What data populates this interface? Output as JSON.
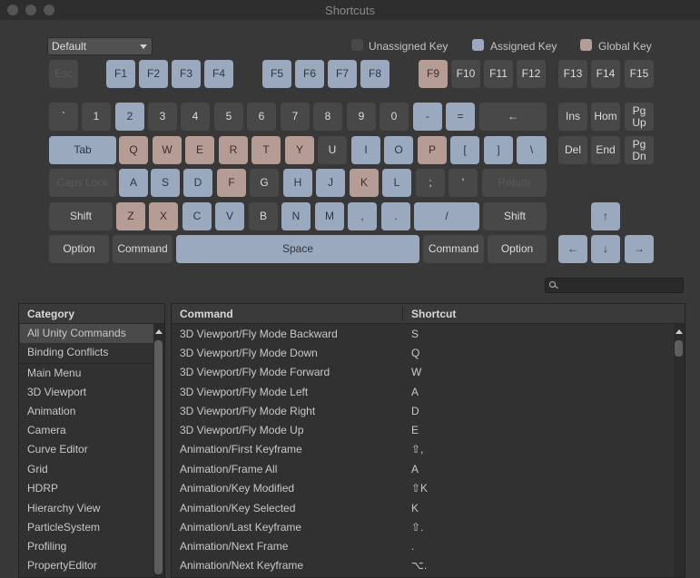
{
  "window": {
    "title": "Shortcuts"
  },
  "profile_dropdown": {
    "value": "Default"
  },
  "legend": {
    "unassigned": "Unassigned Key",
    "assigned": "Assigned Key",
    "global": "Global Key",
    "colors": {
      "unassigned": "#484848",
      "assigned": "#9aa9bd",
      "global": "#b59d95"
    }
  },
  "keys": {
    "esc": "Esc",
    "f1": "F1",
    "f2": "F2",
    "f3": "F3",
    "f4": "F4",
    "f5": "F5",
    "f6": "F6",
    "f7": "F7",
    "f8": "F8",
    "f9": "F9",
    "f10": "F10",
    "f11": "F11",
    "f12": "F12",
    "f13": "F13",
    "f14": "F14",
    "f15": "F15",
    "backtick": "`",
    "n1": "1",
    "n2": "2",
    "n3": "3",
    "n4": "4",
    "n5": "5",
    "n6": "6",
    "n7": "7",
    "n8": "8",
    "n9": "9",
    "n0": "0",
    "minus": "-",
    "equals": "=",
    "backspace": "←",
    "ins": "Ins",
    "home": "Hom",
    "pgup1": "Pg",
    "pgup2": "Up",
    "tab": "Tab",
    "q": "Q",
    "w": "W",
    "e": "E",
    "r": "R",
    "t": "T",
    "y": "Y",
    "u": "U",
    "i": "I",
    "o": "O",
    "p": "P",
    "lbracket": "[",
    "rbracket": "]",
    "backslash": "\\",
    "del": "Del",
    "end": "End",
    "pgdn1": "Pg",
    "pgdn2": "Dn",
    "capslock": "Caps Lock",
    "a": "A",
    "s": "S",
    "d": "D",
    "f": "F",
    "g": "G",
    "h": "H",
    "j": "J",
    "k": "K",
    "l": "L",
    "semicolon": ";",
    "quote": "'",
    "return": "Return",
    "shift_l": "Shift",
    "z": "Z",
    "x": "X",
    "c": "C",
    "v": "V",
    "b": "B",
    "n": "N",
    "m": "M",
    "comma": ",",
    "period": ".",
    "slash": "/",
    "shift_r": "Shift",
    "option_l": "Option",
    "command_l": "Command",
    "space": "Space",
    "command_r": "Command",
    "option_r": "Option",
    "arrow_up": "↑",
    "arrow_left": "←",
    "arrow_down": "↓",
    "arrow_right": "→"
  },
  "category_panel": {
    "header": "Category",
    "items": [
      "All Unity Commands",
      "Binding Conflicts",
      "Main Menu",
      "3D Viewport",
      "Animation",
      "Camera",
      "Curve Editor",
      "Grid",
      "HDRP",
      "Hierarchy View",
      "ParticleSystem",
      "Profiling",
      "PropertyEditor"
    ],
    "selected": "All Unity Commands"
  },
  "command_table": {
    "headers": {
      "command": "Command",
      "shortcut": "Shortcut"
    },
    "rows": [
      {
        "command": "3D Viewport/Fly Mode Backward",
        "shortcut": "S"
      },
      {
        "command": "3D Viewport/Fly Mode Down",
        "shortcut": "Q"
      },
      {
        "command": "3D Viewport/Fly Mode Forward",
        "shortcut": "W"
      },
      {
        "command": "3D Viewport/Fly Mode Left",
        "shortcut": "A"
      },
      {
        "command": "3D Viewport/Fly Mode Right",
        "shortcut": "D"
      },
      {
        "command": "3D Viewport/Fly Mode Up",
        "shortcut": "E"
      },
      {
        "command": "Animation/First Keyframe",
        "shortcut": "⇧,"
      },
      {
        "command": "Animation/Frame All",
        "shortcut": "A"
      },
      {
        "command": "Animation/Key Modified",
        "shortcut": "⇧K"
      },
      {
        "command": "Animation/Key Selected",
        "shortcut": "K"
      },
      {
        "command": "Animation/Last Keyframe",
        "shortcut": "⇧."
      },
      {
        "command": "Animation/Next Frame",
        "shortcut": "."
      },
      {
        "command": "Animation/Next Keyframe",
        "shortcut": "⌥."
      }
    ]
  }
}
